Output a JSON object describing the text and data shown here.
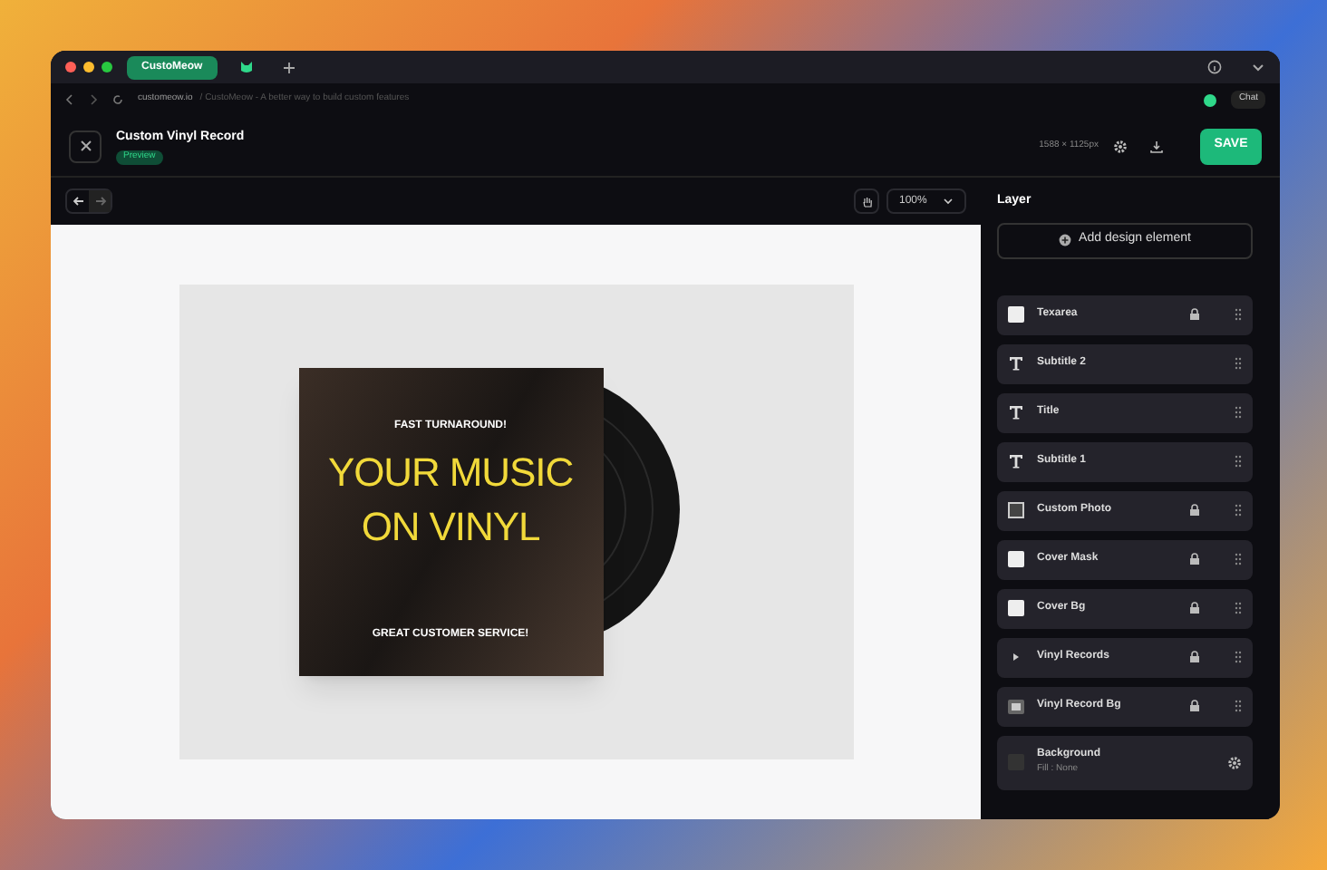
{
  "browser": {
    "tab": "CustoMeow",
    "address": "customeow.io",
    "address_path": "/ CustoMeow - A better way to build custom features",
    "chat": "Chat"
  },
  "header": {
    "title": "Custom Vinyl Record",
    "badge": "Preview",
    "size": "1588 × 1125px",
    "save": "SAVE"
  },
  "toolbar": {
    "zoom": "100%"
  },
  "design": {
    "top_text": "FAST TURNAROUND!",
    "headline": "YOUR MUSIC ON VINYL",
    "bottom_text": "GREAT CUSTOMER SERVICE!"
  },
  "panel": {
    "title": "Layer",
    "add_button": "Add design element",
    "layers": [
      {
        "kind": "image",
        "label": "Texarea",
        "locked": true
      },
      {
        "kind": "text",
        "label": "Subtitle 2",
        "locked": false
      },
      {
        "kind": "text",
        "label": "Title",
        "locked": false
      },
      {
        "kind": "text",
        "label": "Subtitle 1",
        "locked": false
      },
      {
        "kind": "photo",
        "label": "Custom Photo",
        "locked": true
      },
      {
        "kind": "image",
        "label": "Cover Mask",
        "locked": true
      },
      {
        "kind": "image",
        "label": "Cover Bg",
        "locked": true
      },
      {
        "kind": "group",
        "label": "Vinyl Records",
        "locked": true
      },
      {
        "kind": "picture",
        "label": "Vinyl Record Bg",
        "locked": true
      }
    ],
    "background": {
      "label": "Background",
      "fill": "Fill : None"
    }
  }
}
